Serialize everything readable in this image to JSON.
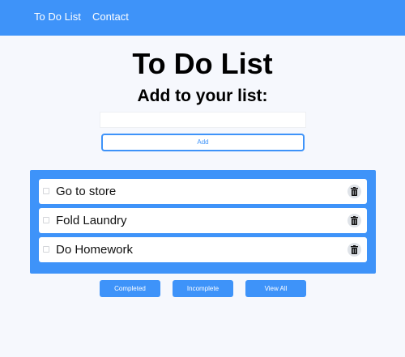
{
  "nav": {
    "links": [
      "To Do List",
      "Contact"
    ]
  },
  "header": {
    "title": "To Do List",
    "subtitle": "Add to your list:"
  },
  "form": {
    "input_value": "",
    "add_label": "Add"
  },
  "todos": [
    {
      "text": "Go to store",
      "checked": false
    },
    {
      "text": "Fold Laundry",
      "checked": false
    },
    {
      "text": "Do Homework",
      "checked": false
    }
  ],
  "filters": [
    "Completed",
    "Incomplete",
    "View All"
  ],
  "colors": {
    "accent": "#3e93f9",
    "background": "#f6f8fd"
  },
  "icons": {
    "delete": "trash-icon",
    "checkbox": "checkbox"
  }
}
